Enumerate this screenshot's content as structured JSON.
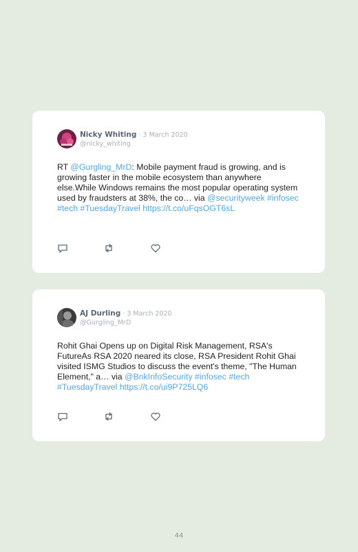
{
  "tweets": [
    {
      "author": "Nicky Whiting",
      "separator": " · ",
      "date": "3 March 2020",
      "handle": "@nicky_whiting",
      "text_parts": [
        {
          "t": "RT ",
          "link": false
        },
        {
          "t": "@Gurgling_MrD",
          "link": true
        },
        {
          "t": ": Mobile payment fraud is growing, and is growing faster in the mobile ecosystem than anywhere else.While Windows remains the most popular operating system used by fraudsters at 38%, the co… via ",
          "link": false
        },
        {
          "t": "@securityweek",
          "link": true
        },
        {
          "t": " ",
          "link": false
        },
        {
          "t": "#infosec",
          "link": true
        },
        {
          "t": " ",
          "link": false
        },
        {
          "t": "#tech",
          "link": true
        },
        {
          "t": " ",
          "link": false
        },
        {
          "t": "#TuesdayTravel",
          "link": true
        },
        {
          "t": " ",
          "link": false
        },
        {
          "t": "https://t.co/uFqsOGT6sL",
          "link": true
        }
      ],
      "avatar_icon": "avatar-pink-icon"
    },
    {
      "author": "AJ Durling",
      "separator": " · ",
      "date": "3 March 2020",
      "handle": "@Gurgling_MrD",
      "text_parts": [
        {
          "t": "Rohit Ghai Opens up on Digital Risk Management, RSA's FutureAs RSA 2020 neared its close, RSA President Rohit Ghai visited ISMG Studios to discuss the event's theme, \"The Human Element,\" a… via ",
          "link": false
        },
        {
          "t": "@BnkInfoSecurity",
          "link": true
        },
        {
          "t": " ",
          "link": false
        },
        {
          "t": "#infosec",
          "link": true
        },
        {
          "t": " ",
          "link": false
        },
        {
          "t": "#tech",
          "link": true
        },
        {
          "t": " ",
          "link": false
        },
        {
          "t": "#TuesdayTravel",
          "link": true
        },
        {
          "t": " ",
          "link": false
        },
        {
          "t": "https://t.co/ui9P725LQ6",
          "link": true
        }
      ],
      "avatar_icon": "avatar-grey-icon"
    }
  ],
  "icons": {
    "reply": "reply-icon",
    "retweet": "retweet-icon",
    "like": "like-icon"
  },
  "colors": {
    "background": "#e4ebe1",
    "card": "#ffffff",
    "link": "#55a5dd",
    "name": "#5a6575",
    "meta": "#a9b0b8",
    "icon": "#5f6b73"
  },
  "page_number": "44"
}
